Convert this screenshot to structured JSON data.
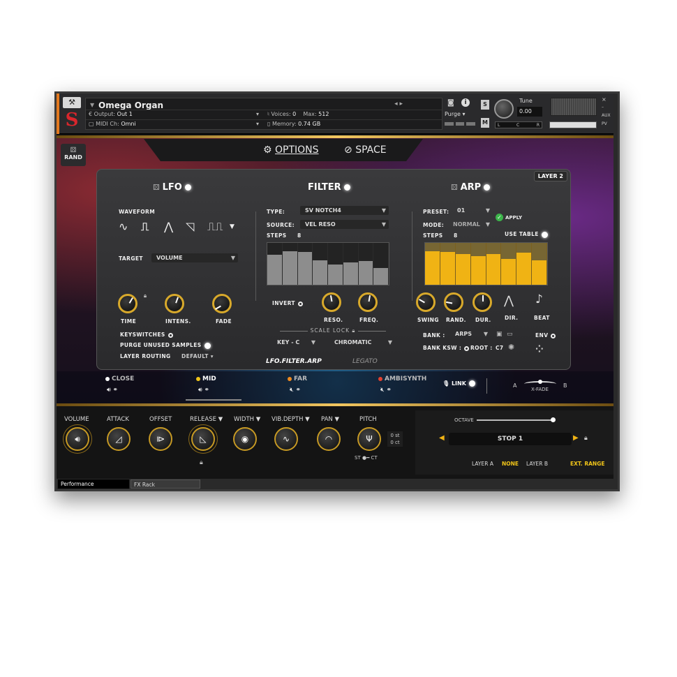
{
  "header": {
    "instrument_name": "Omega Organ",
    "output_label": "Output:",
    "output_value": "Out 1",
    "voices_label": "Voices:",
    "voices_value": "0",
    "max_label": "Max:",
    "max_value": "512",
    "midi_label": "MIDI Ch:",
    "midi_value": "Omni",
    "memory_label": "Memory:",
    "memory_value": "0.74 GB",
    "purge_label": "Purge",
    "tune_label": "Tune",
    "tune_value": "0.00",
    "solo": "S",
    "mute": "M",
    "pan_l": "L",
    "pan_c": "C",
    "pan_r": "R",
    "aux": "AUX",
    "pv": "PV"
  },
  "topbar": {
    "rand_label": "RAND",
    "options_label": "OPTIONS",
    "space_label": "SPACE"
  },
  "panel": {
    "layer_badge": "LAYER 2",
    "lfo": {
      "title": "LFO",
      "waveform_label": "WAVEFORM",
      "target_label": "TARGET",
      "target_value": "VOLUME",
      "knobs": [
        "TIME",
        "INTENS.",
        "FADE"
      ],
      "keyswitches_label": "KEYSWITCHES",
      "purge_label": "PURGE UNUSED SAMPLES",
      "routing_label": "LAYER ROUTING",
      "routing_value": "DEFAULT"
    },
    "filter": {
      "title": "FILTER",
      "type_label": "TYPE:",
      "type_value": "SV NOTCH4",
      "source_label": "SOURCE:",
      "source_value": "VEL RESO",
      "steps_label": "STEPS",
      "steps_value": "8",
      "step_values": [
        0.72,
        0.8,
        0.78,
        0.58,
        0.48,
        0.54,
        0.56,
        0.4
      ],
      "invert_label": "INVERT",
      "knobs": [
        "RESO.",
        "FREQ."
      ],
      "scale_lock_label": "SCALE LOCK",
      "key_value": "KEY - C",
      "scale_value": "CHROMATIC"
    },
    "arp": {
      "title": "ARP",
      "preset_label": "PRESET:",
      "preset_value": "01",
      "apply_label": "APPLY",
      "mode_label": "MODE:",
      "mode_value": "NORMAL",
      "steps_label": "STEPS",
      "steps_value": "8",
      "use_table_label": "USE TABLE",
      "step_values": [
        0.8,
        0.78,
        0.74,
        0.68,
        0.74,
        0.62,
        0.76,
        0.58
      ],
      "knobs": [
        "SWING",
        "RAND.",
        "DUR."
      ],
      "dir_label": "DIR.",
      "beat_label": "BEAT",
      "bank_label": "BANK :",
      "bank_value": "ARPS",
      "bank_ksw_label": "BANK KSW :",
      "root_label": "ROOT :",
      "root_value": "C7",
      "env_label": "ENV"
    },
    "tabs": [
      "LFO.FILTER.ARP",
      "LEGATO"
    ]
  },
  "layers": {
    "items": [
      {
        "name": "CLOSE",
        "color": "#ffffff",
        "text_color": "#bbbbbb"
      },
      {
        "name": "MID",
        "color": "#f0c419",
        "text_color": "#ffffff"
      },
      {
        "name": "FAR",
        "color": "#f08a1e",
        "text_color": "#bbbbbb"
      },
      {
        "name": "AMBISYNTH",
        "color": "#e3412f",
        "text_color": "#bbbbbb"
      }
    ],
    "link_label": "LINK",
    "xfade_a": "A",
    "xfade_b": "B",
    "xfade_label": "X-FADE"
  },
  "bottom": {
    "knobs": [
      "VOLUME",
      "ATTACK",
      "OFFSET",
      "RELEASE ▼",
      "WIDTH ▼",
      "VIB.DEPTH ▼",
      "PAN ▼",
      "PITCH"
    ],
    "pitch_st": "0 st",
    "pitch_ct": "0 ct",
    "st_label": "ST",
    "ct_label": "CT",
    "octave_label": "OCTAVE",
    "stop_label": "STOP 1",
    "layer_a_label": "LAYER A",
    "layer_a_value": "NONE",
    "layer_b_label": "LAYER B",
    "ext_range_label": "EXT. RANGE",
    "accent": "#f0c419"
  },
  "footer": {
    "tab_performance": "Performance",
    "tab_fx": "FX Rack"
  }
}
